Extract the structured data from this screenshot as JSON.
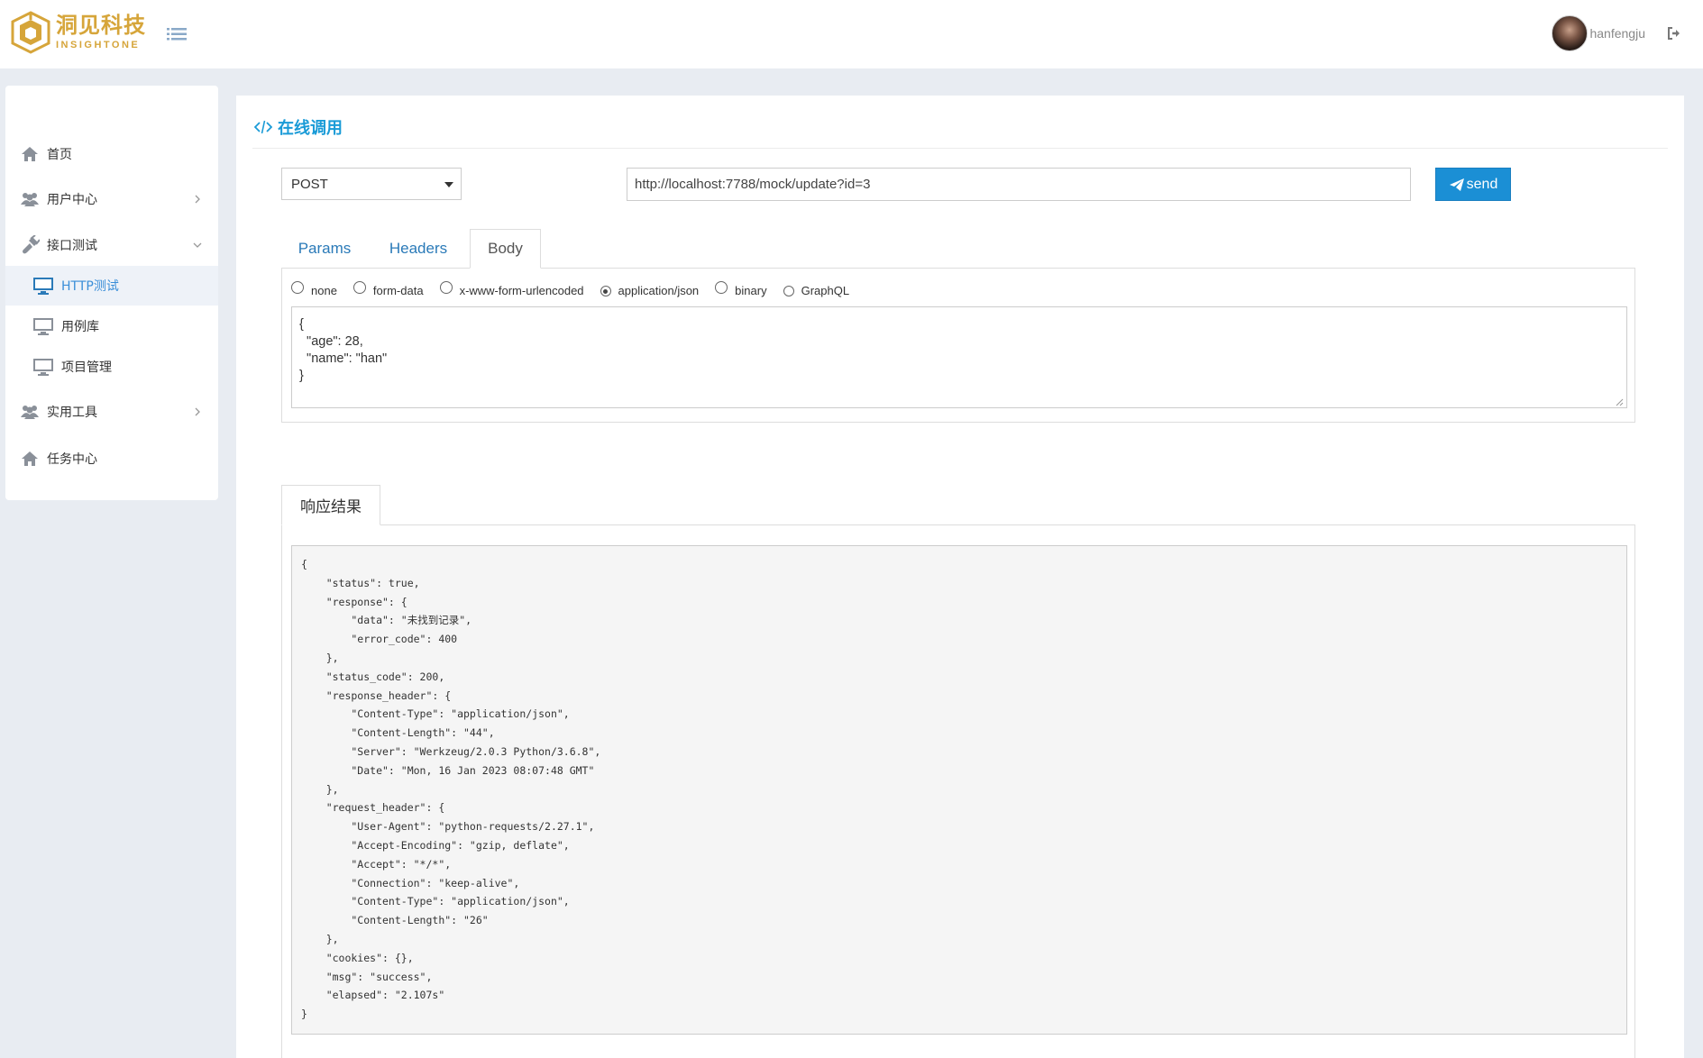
{
  "header": {
    "logo_cn": "洞见科技",
    "logo_en": "INSIGHTONE",
    "username": "hanfengju",
    "brand_color": "#d6a53a"
  },
  "sidebar": {
    "items": [
      {
        "label": "首页",
        "icon": "home-icon"
      },
      {
        "label": "用户中心",
        "icon": "users-icon"
      },
      {
        "label": "接口测试",
        "icon": "plug-icon"
      },
      {
        "label": "实用工具",
        "icon": "users-icon"
      },
      {
        "label": "任务中心",
        "icon": "home-icon"
      }
    ],
    "sub_items": [
      {
        "label": "HTTP测试",
        "icon": "monitor-icon",
        "active": true
      },
      {
        "label": "用例库",
        "icon": "monitor-icon"
      },
      {
        "label": "项目管理",
        "icon": "monitor-icon"
      }
    ]
  },
  "main": {
    "title": "在线调用",
    "method": "POST",
    "url": "http://localhost:7788/mock/update?id=3",
    "send_label": "send",
    "accent_color": "#1b8fd5",
    "tabs": [
      {
        "label": "Params"
      },
      {
        "label": "Headers"
      },
      {
        "label": "Body",
        "active": true
      }
    ],
    "body_types": [
      {
        "label": "none"
      },
      {
        "label": "form-data"
      },
      {
        "label": "x-www-form-urlencoded"
      },
      {
        "label": "application/json",
        "checked": true
      },
      {
        "label": "binary"
      },
      {
        "label": "GraphQL"
      }
    ],
    "body_text": "{\n  \"age\": 28,\n  \"name\": \"han\"\n}",
    "response_tab": "响应结果",
    "response_text": "{\n    \"status\": true,\n    \"response\": {\n        \"data\": \"未找到记录\",\n        \"error_code\": 400\n    },\n    \"status_code\": 200,\n    \"response_header\": {\n        \"Content-Type\": \"application/json\",\n        \"Content-Length\": \"44\",\n        \"Server\": \"Werkzeug/2.0.3 Python/3.6.8\",\n        \"Date\": \"Mon, 16 Jan 2023 08:07:48 GMT\"\n    },\n    \"request_header\": {\n        \"User-Agent\": \"python-requests/2.27.1\",\n        \"Accept-Encoding\": \"gzip, deflate\",\n        \"Accept\": \"*/*\",\n        \"Connection\": \"keep-alive\",\n        \"Content-Type\": \"application/json\",\n        \"Content-Length\": \"26\"\n    },\n    \"cookies\": {},\n    \"msg\": \"success\",\n    \"elapsed\": \"2.107s\"\n}"
  }
}
